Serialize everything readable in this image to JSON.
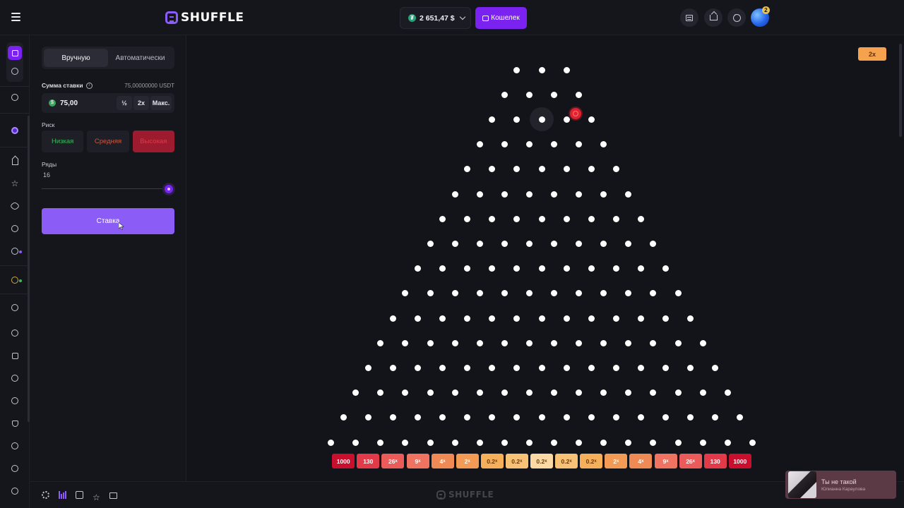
{
  "header": {
    "brand": "SHUFFLE",
    "balance": "2 651,47 $",
    "balance_coin": "₮",
    "wallet_label": "Кошелек",
    "notification_count": "2"
  },
  "panel": {
    "tabs": [
      "Вручную",
      "Автоматически"
    ],
    "bet_amount_label": "Сумма ставки",
    "bet_amount_max_note": "75,00000000 USDT",
    "bet_amount_value": "75,00",
    "bet_coin": "$",
    "half_label": "½",
    "double_label": "2x",
    "max_label": "Макс.",
    "risk_label": "Риск",
    "risk_options": [
      "Низкая",
      "Средняя",
      "Высокая"
    ],
    "risk_selected": "Высокая",
    "rows_label": "Ряды",
    "rows_value": "16",
    "bet_button": "Ставка"
  },
  "game": {
    "last_result": "2x",
    "rows": 16,
    "multipliers": [
      {
        "text": "1000",
        "color": "#c8102e"
      },
      {
        "text": "130",
        "color": "#e23a48"
      },
      {
        "text": "26",
        "color": "#ea5b59"
      },
      {
        "text": "9",
        "color": "#ef7360"
      },
      {
        "text": "4",
        "color": "#f08a55"
      },
      {
        "text": "2",
        "color": "#f39a55"
      },
      {
        "text": "0.2",
        "color": "#f7b05a"
      },
      {
        "text": "0.2",
        "color": "#f8c276"
      },
      {
        "text": "0.2",
        "color": "#fbd9a5"
      },
      {
        "text": "0.2",
        "color": "#f8c276"
      },
      {
        "text": "0.2",
        "color": "#f7b05a"
      },
      {
        "text": "2",
        "color": "#f39a55"
      },
      {
        "text": "4",
        "color": "#f08a55"
      },
      {
        "text": "9",
        "color": "#ef7360"
      },
      {
        "text": "26",
        "color": "#ea5b59"
      },
      {
        "text": "130",
        "color": "#e23a48"
      },
      {
        "text": "1000",
        "color": "#c8102e"
      }
    ],
    "x_suffix": "x"
  },
  "footer": {
    "brand": "SHUFFLE"
  },
  "now_playing": {
    "title": "Ты не такой",
    "artist": "Юлианна Караулова"
  },
  "colors": {
    "accent": "#7a22f0",
    "bet_button": "#8c5cf6",
    "risk_high_bg": "#9c1b2e",
    "ball": "#e0222f",
    "last_result": "#f5a14e"
  }
}
